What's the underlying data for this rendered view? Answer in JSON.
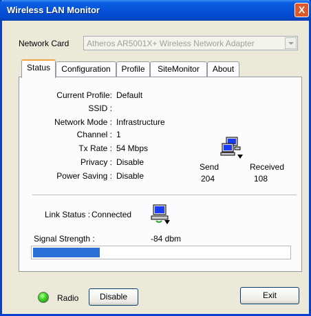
{
  "window": {
    "title": "Wireless LAN Monitor",
    "close_glyph": "X"
  },
  "network_card": {
    "label": "Network Card",
    "value": "Atheros AR5001X+ Wireless Network Adapter"
  },
  "tabs": [
    {
      "label": "Status",
      "active": true
    },
    {
      "label": "Configuration",
      "active": false
    },
    {
      "label": "Profile",
      "active": false
    },
    {
      "label": "SiteMonitor",
      "active": false
    },
    {
      "label": "About",
      "active": false
    }
  ],
  "status": {
    "current_profile": {
      "label": "Current Profile:",
      "value": "Default"
    },
    "ssid": {
      "label": "SSID :",
      "value": ""
    },
    "network_mode": {
      "label": "Network Mode :",
      "value": "Infrastructure"
    },
    "channel": {
      "label": "Channel :",
      "value": "1"
    },
    "tx_rate": {
      "label": "Tx Rate :",
      "value": "54 Mbps"
    },
    "privacy": {
      "label": "Privacy :",
      "value": "Disable"
    },
    "power_saving": {
      "label": "Power Saving :",
      "value": "Disable"
    }
  },
  "traffic": {
    "send_label": "Send",
    "send_value": "204",
    "received_label": "Received",
    "received_value": "108"
  },
  "link": {
    "label": "Link Status :",
    "value": "Connected"
  },
  "signal": {
    "label": "Signal Strength :",
    "value": "-84 dbm",
    "level_fraction": 0.26,
    "bar_color": "#2a6fd6"
  },
  "footer": {
    "radio_label": "Radio",
    "radio_button": "Disable",
    "exit_button": "Exit",
    "led_color": "#39d11d"
  },
  "icons": {
    "traffic_icon": "computer-network-icon",
    "link_icon": "computer-connected-icon"
  }
}
